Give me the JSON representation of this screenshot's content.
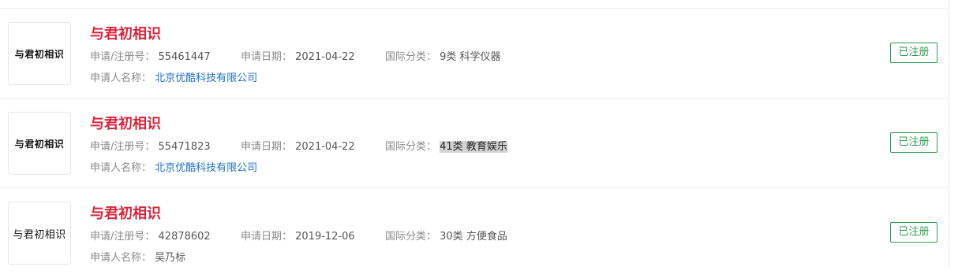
{
  "labels": {
    "reg_no": "申请/注册号：",
    "app_date": "申请日期：",
    "intl_class": "国际分类：",
    "applicant": "申请人名称："
  },
  "records": [
    {
      "logo_text": "与君初相识",
      "name": "与君初相识",
      "reg_no": "55461447",
      "app_date": "2021-04-22",
      "intl_class": "9类 科学仪器",
      "applicant": "北京优酷科技有限公司",
      "status": "已注册"
    },
    {
      "logo_text": "与君初相识",
      "name": "与君初相识",
      "reg_no": "55471823",
      "app_date": "2021-04-22",
      "intl_class": "41类 教育娱乐",
      "applicant": "北京优酷科技有限公司",
      "status": "已注册"
    },
    {
      "logo_text": "与君初相识",
      "name": "与君初相识",
      "reg_no": "42878602",
      "app_date": "2019-12-06",
      "intl_class": "30类 方便食品",
      "applicant": "吴乃标",
      "status": "已注册"
    }
  ],
  "colors": {
    "name": "#d8253a",
    "link": "#1e6fc2",
    "status": "#2f9a4f"
  }
}
